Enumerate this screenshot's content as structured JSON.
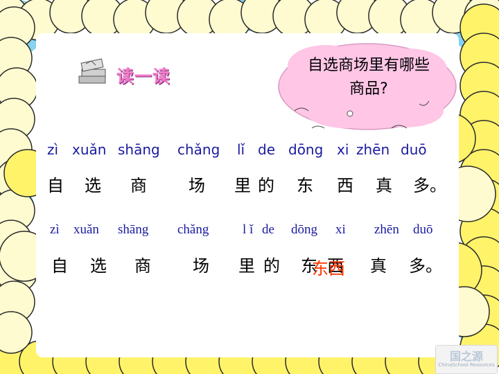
{
  "colors": {
    "cloud_fill": "#fff36a",
    "cloud_light": "#fffbd0",
    "sky": "#86d2f0",
    "bubble": "#ffc6e6",
    "pinyin": "#1a1aa0",
    "overlay_text": "#ff3300",
    "title": "#f27bc8"
  },
  "heading": {
    "icon": "books-icon",
    "text": "读一读"
  },
  "bubble": {
    "line1": "自选商场里有哪些",
    "line2": "商品?"
  },
  "sentence1": {
    "pinyin": [
      "zì",
      "xuǎn",
      "shāng",
      "chǎng",
      "lǐ",
      "de",
      "dōng",
      "xi",
      "zhēn",
      "duō"
    ],
    "hanzi": [
      "自",
      "选",
      "商",
      "场",
      "里",
      "的",
      "东",
      "西",
      "真",
      "多。"
    ]
  },
  "sentence2": {
    "pinyin": [
      "zì",
      "xuǎn",
      "shāng",
      "chǎng",
      "l ǐ",
      "de",
      "dōng",
      "xi",
      "zhēn",
      "duō"
    ],
    "hanzi": [
      "自",
      "选",
      "商",
      "场",
      "里",
      "的",
      "东",
      "西",
      "真",
      "多。"
    ],
    "overlay": "东西"
  },
  "logo": {
    "main": "国之源",
    "sub": "ChinaSchool Resources"
  }
}
